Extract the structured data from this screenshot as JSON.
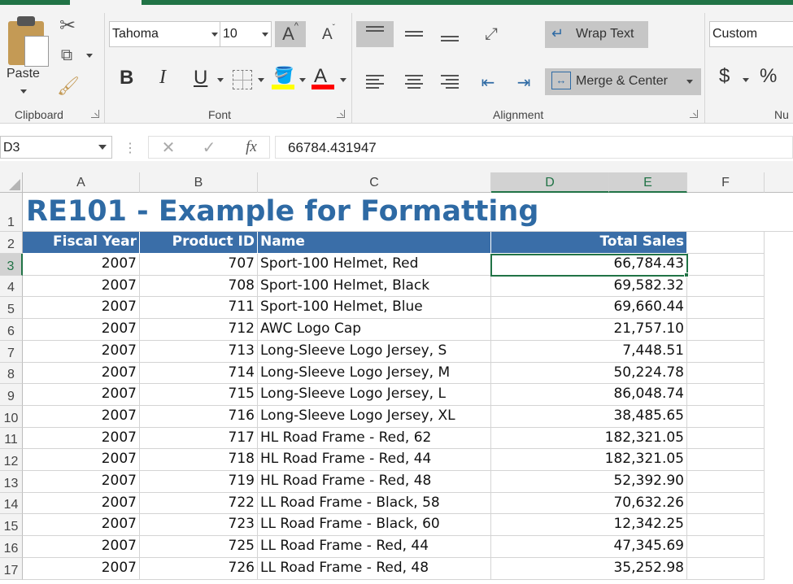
{
  "ribbon": {
    "clipboard": {
      "paste_label": "Paste",
      "group_label": "Clipboard"
    },
    "font": {
      "family": "Tahoma",
      "size": "10",
      "group_label": "Font",
      "bold": "B",
      "italic": "I",
      "underline": "U",
      "grow": "A",
      "shrink": "A",
      "font_color_letter": "A",
      "highlight_color": "#ffff00",
      "font_color": "#ff0000"
    },
    "alignment": {
      "wrap_text": "Wrap Text",
      "merge_center": "Merge & Center",
      "group_label": "Alignment"
    },
    "number": {
      "format": "Custom",
      "currency": "$",
      "percent": "%",
      "group_label": "Nu"
    }
  },
  "formula_bar": {
    "name_box": "D3",
    "fx": "fx",
    "value": "66784.431947"
  },
  "columns": [
    "A",
    "B",
    "C",
    "D",
    "E",
    "F"
  ],
  "selected_column": "D",
  "selected_row": "3",
  "title": "RE101 - Example for Formatting",
  "headers": {
    "fiscal_year": "Fiscal Year",
    "product_id": "Product ID",
    "name": "Name",
    "total_sales": "Total Sales"
  },
  "rows": [
    {
      "row": "3",
      "year": "2007",
      "pid": "707",
      "name": "Sport-100 Helmet, Red",
      "sales": "66,784.43"
    },
    {
      "row": "4",
      "year": "2007",
      "pid": "708",
      "name": "Sport-100 Helmet, Black",
      "sales": "69,582.32"
    },
    {
      "row": "5",
      "year": "2007",
      "pid": "711",
      "name": "Sport-100 Helmet, Blue",
      "sales": "69,660.44"
    },
    {
      "row": "6",
      "year": "2007",
      "pid": "712",
      "name": "AWC Logo Cap",
      "sales": "21,757.10"
    },
    {
      "row": "7",
      "year": "2007",
      "pid": "713",
      "name": "Long-Sleeve Logo Jersey, S",
      "sales": "7,448.51"
    },
    {
      "row": "8",
      "year": "2007",
      "pid": "714",
      "name": "Long-Sleeve Logo Jersey, M",
      "sales": "50,224.78"
    },
    {
      "row": "9",
      "year": "2007",
      "pid": "715",
      "name": "Long-Sleeve Logo Jersey, L",
      "sales": "86,048.74"
    },
    {
      "row": "10",
      "year": "2007",
      "pid": "716",
      "name": "Long-Sleeve Logo Jersey, XL",
      "sales": "38,485.65"
    },
    {
      "row": "11",
      "year": "2007",
      "pid": "717",
      "name": "HL Road Frame - Red, 62",
      "sales": "182,321.05"
    },
    {
      "row": "12",
      "year": "2007",
      "pid": "718",
      "name": "HL Road Frame - Red, 44",
      "sales": "182,321.05"
    },
    {
      "row": "13",
      "year": "2007",
      "pid": "719",
      "name": "HL Road Frame - Red, 48",
      "sales": "52,392.90"
    },
    {
      "row": "14",
      "year": "2007",
      "pid": "722",
      "name": "LL Road Frame - Black, 58",
      "sales": "70,632.26"
    },
    {
      "row": "15",
      "year": "2007",
      "pid": "723",
      "name": "LL Road Frame - Black, 60",
      "sales": "12,342.25"
    },
    {
      "row": "16",
      "year": "2007",
      "pid": "725",
      "name": "LL Road Frame - Red, 44",
      "sales": "47,345.69"
    },
    {
      "row": "17",
      "year": "2007",
      "pid": "726",
      "name": "LL Road Frame - Red, 48",
      "sales": "35,252.98"
    }
  ],
  "row_numbers": {
    "r1": "1",
    "r2": "2"
  }
}
